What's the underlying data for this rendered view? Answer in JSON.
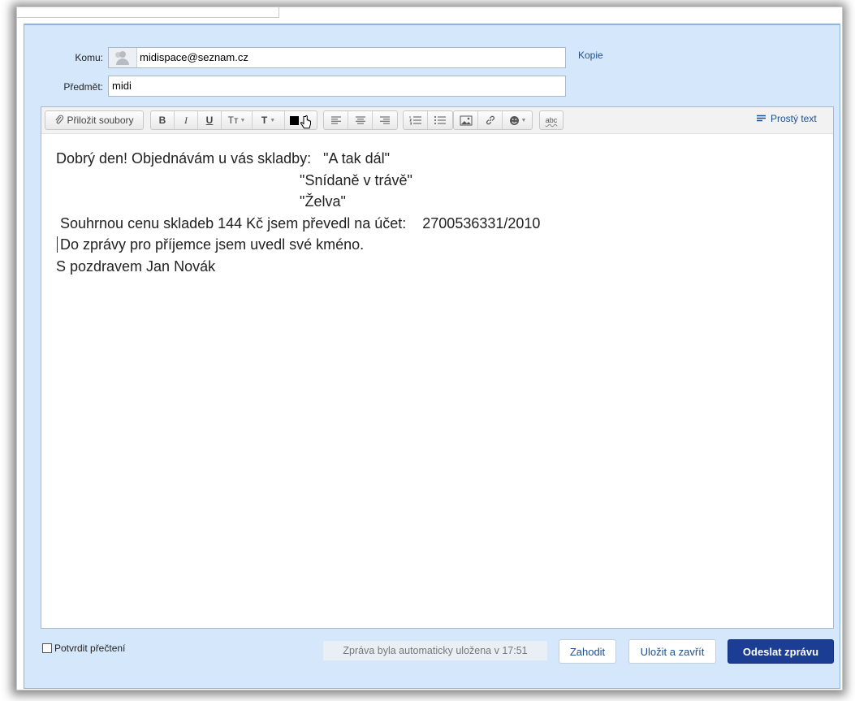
{
  "form": {
    "to_label": "Komu:",
    "to_value": "midispace@seznam.cz",
    "cc_link": "Kopie",
    "subject_label": "Předmět:",
    "subject_value": "midi"
  },
  "toolbar": {
    "attach_label": "Přiložit soubory",
    "bold": "B",
    "italic": "I",
    "underline": "U",
    "font_size": "Tт",
    "font_style": "T",
    "plain_text_label": "Prostý text",
    "spellcheck": "abc"
  },
  "message_lines": [
    "Dobrý den! Objednávám u vás skladby:   \"A tak dál\"",
    "                                                            \"Snídaně v trávě\"",
    "                                                            \"Želva\"",
    " Souhrnou cenu skladeb 144 Kč jsem převedl na účet:    2700536331/2010",
    " Do zprávy pro příjemce jsem uvedl své kméno.",
    "S pozdravem Jan Novák"
  ],
  "footer": {
    "read_receipt_label": "Potvrdit přečtení",
    "autosave_status": "Zpráva byla automaticky uložena v 17:51",
    "discard_button": "Zahodit",
    "save_close_button": "Uložit a zavřít",
    "send_button": "Odeslat zprávu"
  },
  "colors": {
    "panel_bg": "#d5e7fb",
    "link": "#1d4f91",
    "send_bg": "#1b3d94"
  }
}
